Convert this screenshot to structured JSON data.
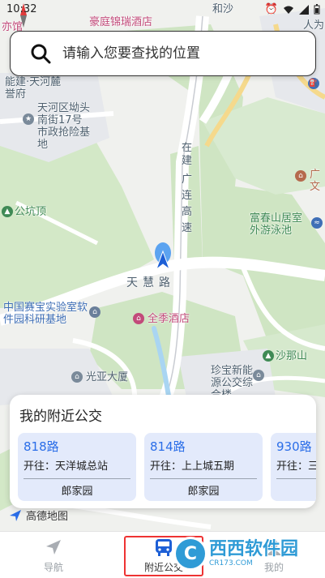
{
  "status_bar": {
    "time": "10:32"
  },
  "search": {
    "placeholder": "请输入您要查找的位置"
  },
  "map": {
    "labels": {
      "hotel_top": "豪庭锦瑞酒店",
      "road_top": "和沙",
      "corner_left": "亦馆",
      "corner_right": "人为",
      "resident": "能建·天河麓誉府",
      "flood_base": "天河区坳头南街17号市政抢险基地",
      "expressway": "广连高速",
      "expressway_prefix": "在建",
      "gongkeng": "公坑顶",
      "fuchun": "富春山居室外游泳池",
      "guang_corner": "广文",
      "tianhui_road": "天慧路",
      "saibao": "中国赛宝实验室软件园科研基地",
      "quanji": "全季酒店",
      "guangya": "光亚大厦",
      "zhenbao": "珍宝新能源公交综合楼",
      "shanaling": "沙那山",
      "amap_logo": "高德地图"
    }
  },
  "panel": {
    "title": "我的附近公交",
    "cards": [
      {
        "route": "818路",
        "dest": "开往：天洋城总站",
        "from": "郎家园"
      },
      {
        "route": "814路",
        "dest": "开往：上上城五期",
        "from": "郎家园"
      },
      {
        "route": "930路",
        "dest": "开往：三",
        "from": ""
      }
    ]
  },
  "nav": {
    "items": [
      {
        "label": "导航",
        "icon": "navigate-arrow-icon"
      },
      {
        "label": "附近公交",
        "icon": "bus-icon"
      },
      {
        "label": "我的",
        "icon": "user-icon"
      }
    ]
  },
  "watermark": {
    "text": "西西软件园",
    "url": "CR173.COM"
  },
  "colors": {
    "accent": "#2b6ee8",
    "card_bg": "#e3eafb",
    "selection": "#e33333"
  }
}
